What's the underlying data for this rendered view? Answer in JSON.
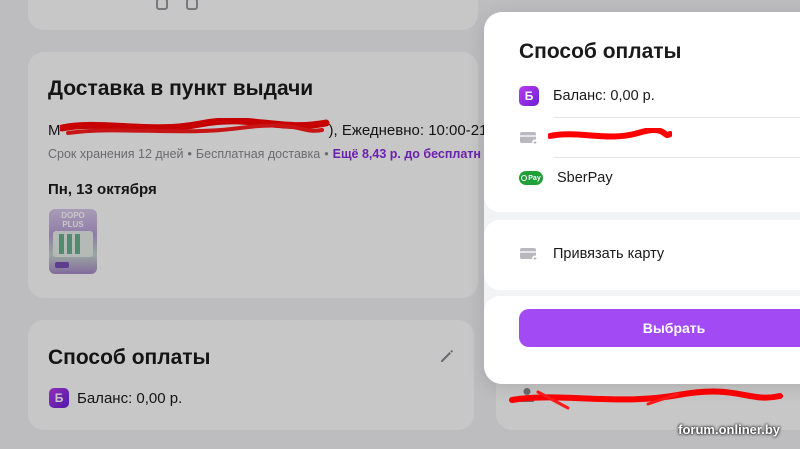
{
  "delivery": {
    "title": "Доставка в пункт выдачи",
    "address_visible_prefix": "М",
    "address_visible_suffix": "), Ежедневно: 10:00-21:0",
    "storage": "Срок хранения 12 дней",
    "free_delivery": "Бесплатная доставка",
    "promo": "Ещё 8,43 р. до бесплатн",
    "date": "Пн, 13 октября",
    "product_label": "DOPO PLUS"
  },
  "payment_bg": {
    "title": "Способ оплаты",
    "balance": "Баланс: 0,00 р."
  },
  "modal": {
    "title": "Способ оплаты",
    "options": [
      {
        "icon": "balance-icon",
        "label": "Баланс: 0,00 р."
      },
      {
        "icon": "card-icon",
        "label": ""
      },
      {
        "icon": "sberpay-icon",
        "label": "SberPay"
      }
    ],
    "link_card": "Привязать карту",
    "select_button": "Выбрать"
  },
  "badges": {
    "balance_letter": "Б",
    "sberpay_badge": "Pay"
  },
  "watermark": "forum.onliner.by",
  "colors": {
    "accent": "#a24af4",
    "promo": "#8a2be2",
    "sberpay": "#21a038",
    "redaction": "#ff0000"
  }
}
